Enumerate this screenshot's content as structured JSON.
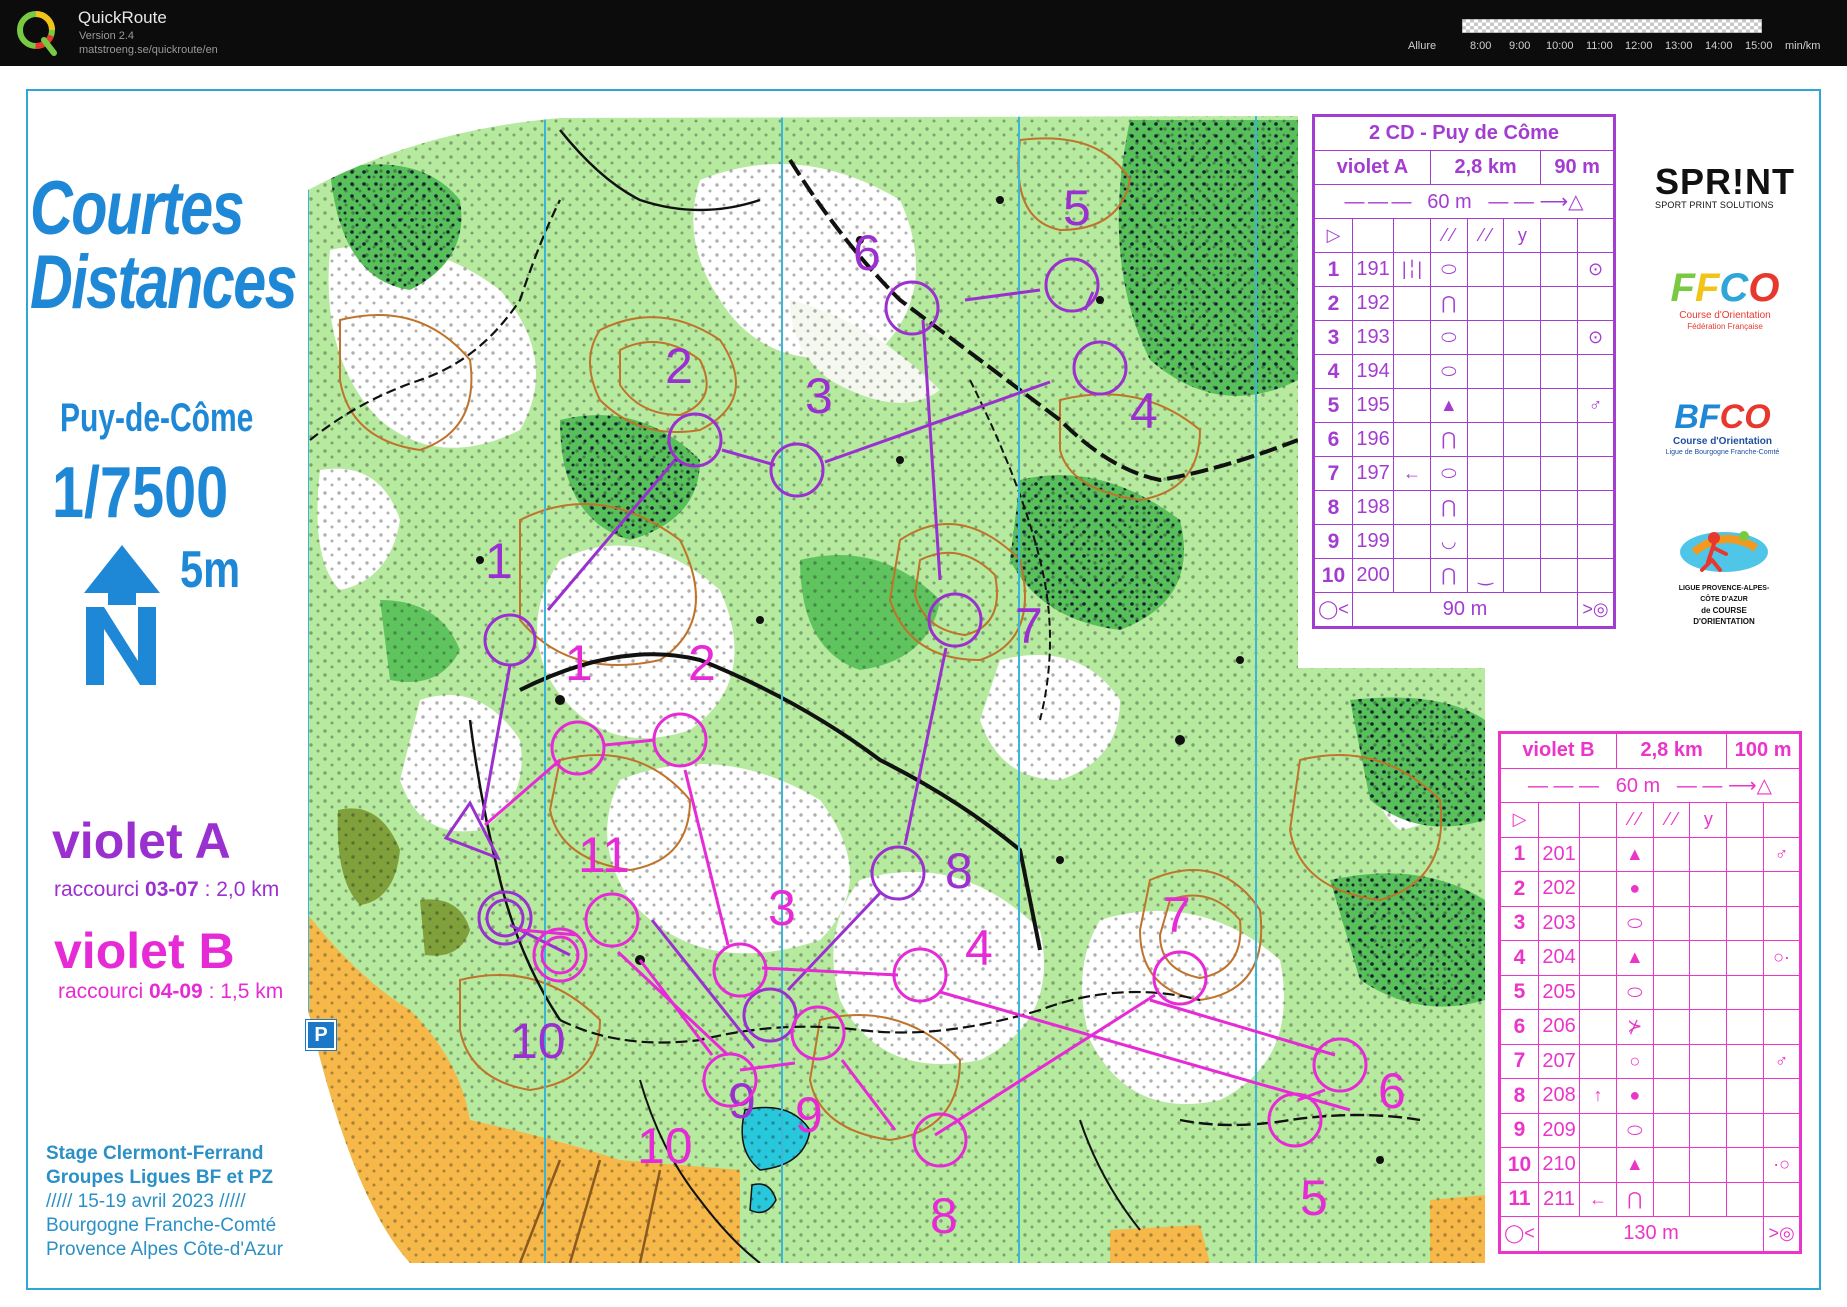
{
  "app": {
    "name": "QuickRoute",
    "version": "Version 2.4",
    "url": "matstroeng.se/quickroute/en",
    "pace_label": "Allure",
    "pace_ticks": [
      "8:00",
      "9:00",
      "10:00",
      "11:00",
      "12:00",
      "13:00",
      "14:00",
      "15:00",
      "min/km"
    ]
  },
  "map": {
    "title": [
      "Courtes",
      "Distances"
    ],
    "place": "Puy-de-Côme",
    "scale": "1/7500",
    "equidistance": "5m",
    "courses": {
      "a": {
        "name": "violet A",
        "shortcut_prefix": "raccourci ",
        "shortcut_controls": "03-07",
        "shortcut_suffix": " : 2,0 km"
      },
      "b": {
        "name": "violet B",
        "shortcut_prefix": "raccourci ",
        "shortcut_controls": "04-09",
        "shortcut_suffix": " : 1,5 km"
      }
    },
    "event": {
      "line1": "Stage Clermont-Ferrand",
      "line2": "Groupes Ligues BF et PZ",
      "line3": "///// 15-19 avril 2023  /////",
      "line4": "Bourgogne Franche-Comté",
      "line5": "Provence Alpes Côte-d'Azur"
    },
    "parking_symbol": "P",
    "colors": {
      "course_a": "#9b30d0",
      "course_b": "#e62ad6",
      "title_blue": "#1e88d6",
      "forest_white": "#ffffff",
      "vegetation_green": "#9fe08a",
      "dense_green": "#4fbf55",
      "contour_brown": "#c0732a",
      "open_yellow": "#f7b84a",
      "water_blue": "#28c8dc",
      "magnetic_north_lines": "#3ab6d8"
    },
    "control_labels_a": [
      "1",
      "2",
      "3",
      "4",
      "5",
      "6",
      "7",
      "8",
      "9",
      "10"
    ],
    "control_labels_b": [
      "1",
      "2",
      "3",
      "4",
      "5",
      "6",
      "7",
      "8",
      "9",
      "10",
      "11"
    ]
  },
  "cd_a": {
    "title": "2 CD - Puy de Côme",
    "course": "violet A",
    "length": "2,8 km",
    "climb": "90 m",
    "start_to_first": "60 m",
    "finish_row": "90 m",
    "rows": [
      {
        "n": "1",
        "code": "191",
        "c": "|╎|",
        "d": "⬭",
        "h": "⊙"
      },
      {
        "n": "2",
        "code": "192",
        "c": "",
        "d": "⋂",
        "h": ""
      },
      {
        "n": "3",
        "code": "193",
        "c": "",
        "d": "⬭",
        "h": "⊙"
      },
      {
        "n": "4",
        "code": "194",
        "c": "",
        "d": "⬭",
        "h": ""
      },
      {
        "n": "5",
        "code": "195",
        "c": "",
        "d": "▲",
        "h": "♂"
      },
      {
        "n": "6",
        "code": "196",
        "c": "",
        "d": "⋂",
        "h": ""
      },
      {
        "n": "7",
        "code": "197",
        "c": "←",
        "d": "⬭",
        "h": ""
      },
      {
        "n": "8",
        "code": "198",
        "c": "",
        "d": "⋂",
        "h": ""
      },
      {
        "n": "9",
        "code": "199",
        "c": "",
        "d": "◡",
        "h": ""
      },
      {
        "n": "10",
        "code": "200",
        "c": "",
        "d": "⋂",
        "e": "‿",
        "h": ""
      }
    ]
  },
  "cd_b": {
    "course": "violet B",
    "length": "2,8 km",
    "climb": "100 m",
    "start_to_first": "60 m",
    "finish_row": "130 m",
    "rows": [
      {
        "n": "1",
        "code": "201",
        "c": "",
        "d": "▲",
        "h": "♂"
      },
      {
        "n": "2",
        "code": "202",
        "c": "",
        "d": "●",
        "h": ""
      },
      {
        "n": "3",
        "code": "203",
        "c": "",
        "d": "⬭",
        "h": ""
      },
      {
        "n": "4",
        "code": "204",
        "c": "",
        "d": "▲",
        "h": "○·"
      },
      {
        "n": "5",
        "code": "205",
        "c": "",
        "d": "⬭",
        "h": ""
      },
      {
        "n": "6",
        "code": "206",
        "c": "",
        "d": "⊁",
        "h": ""
      },
      {
        "n": "7",
        "code": "207",
        "c": "",
        "d": "○",
        "h": "♂"
      },
      {
        "n": "8",
        "code": "208",
        "c": "↑",
        "d": "●",
        "h": ""
      },
      {
        "n": "9",
        "code": "209",
        "c": "",
        "d": "⬭",
        "h": ""
      },
      {
        "n": "10",
        "code": "210",
        "c": "",
        "d": "▲",
        "h": "·○"
      },
      {
        "n": "11",
        "code": "211",
        "c": "←",
        "d": "⋂",
        "h": ""
      }
    ]
  },
  "logos": {
    "sprint": "SPR!NT",
    "sprint_sub": "SPORT PRINT SOLUTIONS",
    "ffco": "FFCO",
    "ffco_sub": "Course d'Orientation",
    "ffco_sub2": "Fédération Française",
    "bfco": "BFCO",
    "bfco_sub": "Course d'Orientation",
    "bfco_sub2": "Ligue de Bourgogne Franche-Comté",
    "pz_sub": "LIGUE PROVENCE-ALPES-CÔTE D'AZUR",
    "pz_sub2": "de COURSE D'ORIENTATION"
  }
}
